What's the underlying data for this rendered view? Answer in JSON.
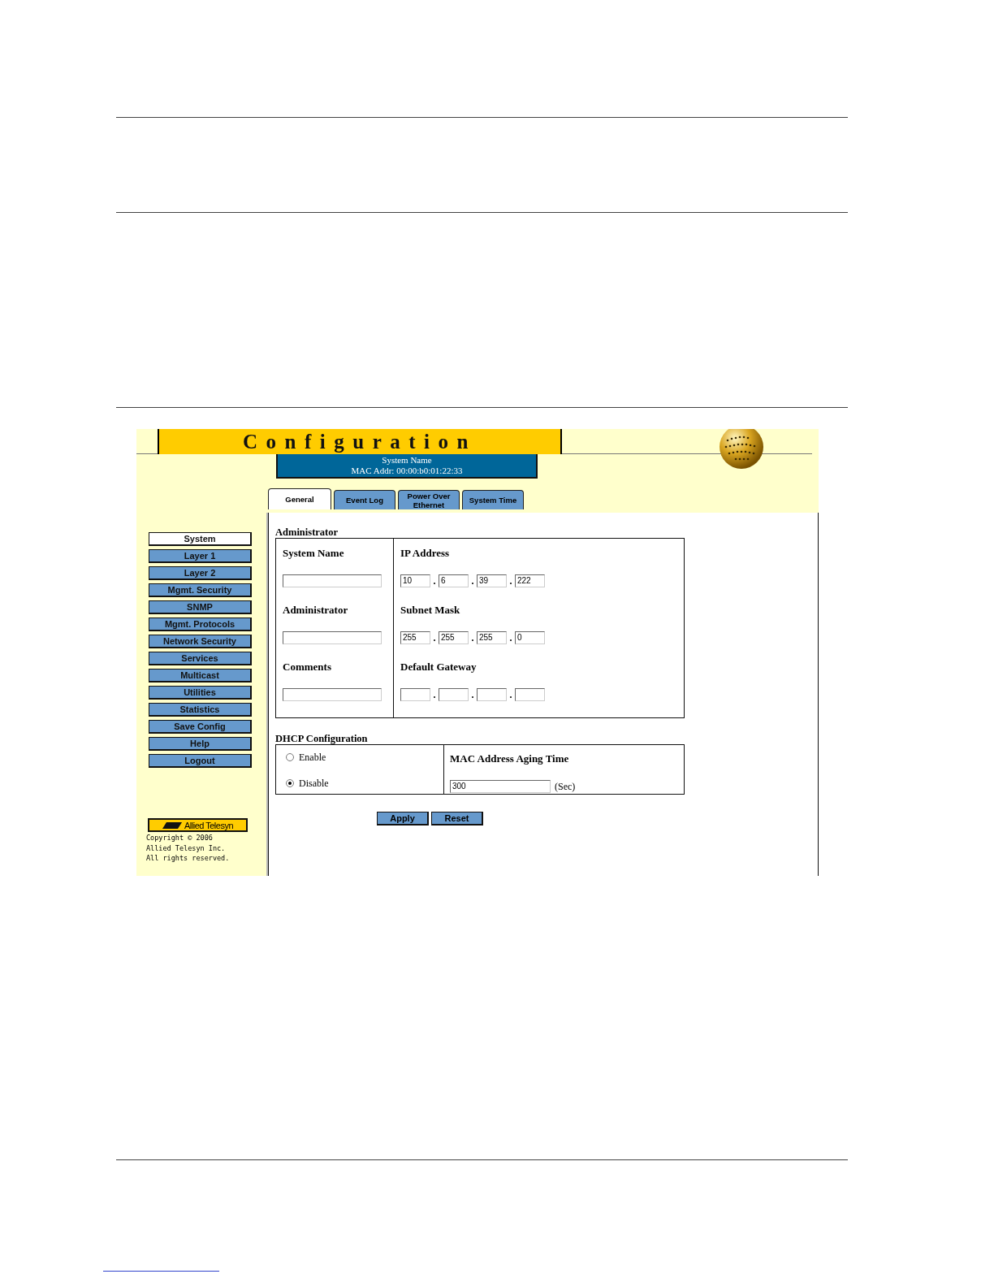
{
  "title": "Configuration",
  "system_info": {
    "system_name": "System Name",
    "mac_address": "MAC Addr:  00:00:b0:01:22:33"
  },
  "tabs": [
    {
      "label": "General",
      "selected": true
    },
    {
      "label": "Event Log",
      "selected": false
    },
    {
      "label": "Power Over Ethernet",
      "selected": false
    },
    {
      "label": "System Time",
      "selected": false
    }
  ],
  "sidebar": {
    "items": [
      {
        "label": "System",
        "selected": true
      },
      {
        "label": "Layer 1",
        "selected": false
      },
      {
        "label": "Layer 2",
        "selected": false
      },
      {
        "label": "Mgmt. Security",
        "selected": false
      },
      {
        "label": "SNMP",
        "selected": false
      },
      {
        "label": "Mgmt. Protocols",
        "selected": false
      },
      {
        "label": "Network Security",
        "selected": false
      },
      {
        "label": "Services",
        "selected": false
      },
      {
        "label": "Multicast",
        "selected": false
      },
      {
        "label": "Utilities",
        "selected": false
      },
      {
        "label": "Statistics",
        "selected": false
      },
      {
        "label": "Save Config",
        "selected": false
      },
      {
        "label": "Help",
        "selected": false
      },
      {
        "label": "Logout",
        "selected": false
      }
    ],
    "logo": "Allied Telesyn",
    "copyright": [
      "Copyright © 2006",
      "Allied Telesyn Inc.",
      "All rights reserved."
    ]
  },
  "administrator": {
    "heading": "Administrator",
    "fields": [
      {
        "label": "System Name"
      },
      {
        "label": "Administrator"
      },
      {
        "label": "Comments"
      }
    ],
    "addresses": [
      {
        "label": "IP Address",
        "octets": [
          "10",
          "6",
          "39",
          "222"
        ],
        "separators": [
          ".",
          ".",
          "."
        ]
      },
      {
        "label": "Subnet Mask",
        "octets": [
          "255",
          "255",
          "255",
          "0"
        ],
        "separators": [
          ".",
          ".",
          "."
        ]
      },
      {
        "label": "Default Gateway",
        "separators": [
          ".",
          ".",
          "."
        ]
      }
    ]
  },
  "dhcp": {
    "heading": "DHCP Configuration",
    "options": [
      {
        "label": "Enable",
        "selected": false
      },
      {
        "label": "Disable",
        "selected": true
      }
    ],
    "aging": {
      "label": "MAC Address Aging Time",
      "value": "300",
      "unit": "(Sec)"
    }
  },
  "buttons": [
    "Apply",
    "Reset"
  ]
}
